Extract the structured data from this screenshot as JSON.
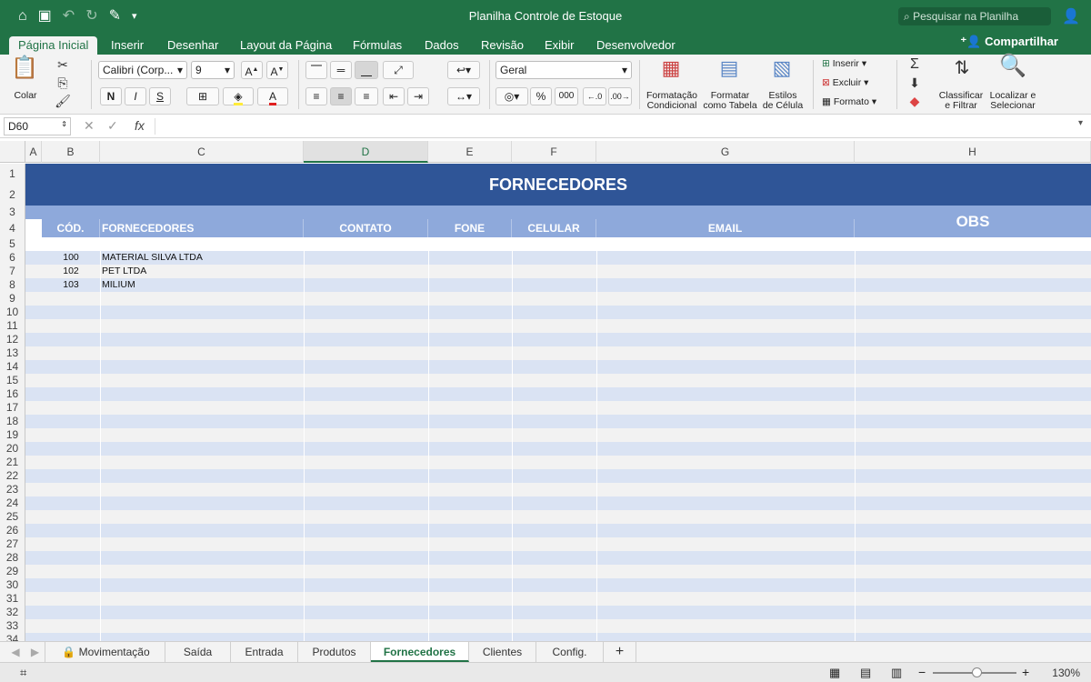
{
  "window": {
    "title": "Planilha Controle de Estoque",
    "search_placeholder": "Pesquisar na Planilha"
  },
  "ribbon_tabs": [
    "Página Inicial",
    "Inserir",
    "Desenhar",
    "Layout da Página",
    "Fórmulas",
    "Dados",
    "Revisão",
    "Exibir",
    "Desenvolvedor"
  ],
  "active_tab": "Página Inicial",
  "share_label": "Compartilhar",
  "ribbon": {
    "paste_label": "Colar",
    "font_name": "Calibri (Corp...",
    "font_size": "9",
    "bold": "N",
    "italic": "I",
    "underline": "S",
    "number_format": "Geral",
    "percent": "%",
    "thousands": "000",
    "cond_format": [
      "Formatação",
      "Condicional"
    ],
    "format_table": [
      "Formatar",
      "como Tabela"
    ],
    "cell_styles": [
      "Estilos",
      "de Célula"
    ],
    "insert": "Inserir",
    "delete": "Excluir",
    "format": "Formato",
    "sort_filter": [
      "Classificar",
      "e Filtrar"
    ],
    "find_select": [
      "Localizar e",
      "Selecionar"
    ]
  },
  "formula_bar": {
    "name_box": "D60",
    "fx": "fx"
  },
  "columns": [
    "A",
    "B",
    "C",
    "D",
    "E",
    "F",
    "G",
    "H"
  ],
  "rows": [
    "1",
    "2",
    "3",
    "4",
    "5",
    "6",
    "7",
    "8",
    "9",
    "10",
    "11",
    "12",
    "13",
    "14",
    "15",
    "16",
    "17",
    "18",
    "19",
    "20",
    "21",
    "22",
    "23",
    "24",
    "25",
    "26",
    "27",
    "28",
    "29",
    "30",
    "31",
    "32",
    "33",
    "34"
  ],
  "sheet": {
    "banner_title": "FORNECEDORES",
    "obs": "OBS",
    "headers": [
      "CÓD.",
      "FORNECEDORES",
      "CONTATO",
      "FONE",
      "CELULAR",
      "EMAIL"
    ],
    "data": [
      {
        "cod": "100",
        "name": "MATERIAL SILVA LTDA"
      },
      {
        "cod": "102",
        "name": "PET LTDA"
      },
      {
        "cod": "103",
        "name": "MILIUM"
      }
    ]
  },
  "sheet_tabs": [
    "Movimentação",
    "Saída",
    "Entrada",
    "Produtos",
    "Fornecedores",
    "Clientes",
    "Config."
  ],
  "active_sheet": "Fornecedores",
  "status": {
    "zoom": "130%"
  },
  "colors": {
    "excel_green": "#217346",
    "banner_blue": "#2f5597",
    "header_blue": "#8ea9db",
    "band_light": "#dae3f3",
    "band_gray": "#f2f2f2"
  }
}
